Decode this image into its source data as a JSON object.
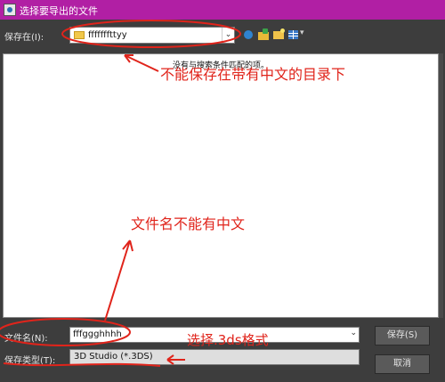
{
  "window": {
    "title": "选择要导出的文件"
  },
  "toolbar": {
    "location_label": "保存在(I):",
    "location_value": "fffffffttyy",
    "dropdown_glyph": "⌄"
  },
  "file_list": {
    "empty_message": "没有与搜索条件匹配的项。"
  },
  "form": {
    "filename_label": "文件名(N):",
    "filename_value": "fffggghhhh",
    "filetype_label": "保存类型(T):",
    "filetype_value": "3D Studio (*.3DS)"
  },
  "buttons": {
    "save": "保存(S)",
    "cancel": "取消"
  },
  "annotations": {
    "note_1": "不能保存在带有中文的目录下",
    "note_2": "文件名不能有中文",
    "note_3": "选择.3ds格式",
    "color": "#e0241b"
  },
  "colors": {
    "titlebar": "#b11fa4",
    "dialog_bg": "#3d3d3d"
  }
}
